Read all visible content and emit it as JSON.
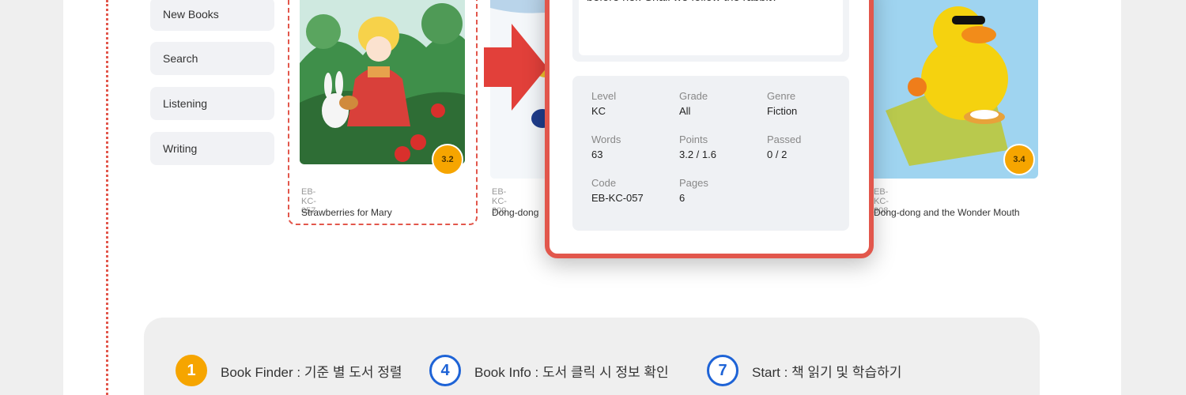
{
  "sidebar": {
    "items": [
      {
        "label": "New Books"
      },
      {
        "label": "Search"
      },
      {
        "label": "Listening"
      },
      {
        "label": "Writing"
      }
    ]
  },
  "books": [
    {
      "code": "EB-KC-057",
      "title": "Strawberries for Mary",
      "level_badge": "3.2"
    },
    {
      "code": "EB-KC-309",
      "title": "Dong-dong"
    },
    {
      "code": "EB-KC-308",
      "title": "Dong-dong and the Wonder Mouth",
      "level_badge": "3.4"
    }
  ],
  "book_info": {
    "description": "strawberries. All of a sudden, a rabbit appears before her. Shall we follow the rabbit?",
    "fields": {
      "level": {
        "label": "Level",
        "value": "KC"
      },
      "grade": {
        "label": "Grade",
        "value": "All"
      },
      "genre": {
        "label": "Genre",
        "value": "Fiction"
      },
      "words": {
        "label": "Words",
        "value": "63"
      },
      "points": {
        "label": "Points",
        "value": "3.2 / 1.6"
      },
      "passed": {
        "label": "Passed",
        "value": "0 / 2"
      },
      "code": {
        "label": "Code",
        "value": "EB-KC-057"
      },
      "pages": {
        "label": "Pages",
        "value": "6"
      }
    }
  },
  "legend": [
    {
      "number": "1",
      "text": "Book Finder : 기준 별 도서 정렬"
    },
    {
      "number": "4",
      "text": "Book Info : 도서 클릭 시 정보 확인"
    },
    {
      "number": "7",
      "text": "Start : 책 읽기 및 학습하기"
    }
  ],
  "colors": {
    "accent_red": "#e2574c",
    "badge_orange": "#f6a500",
    "ring_blue": "#1e63d6"
  }
}
